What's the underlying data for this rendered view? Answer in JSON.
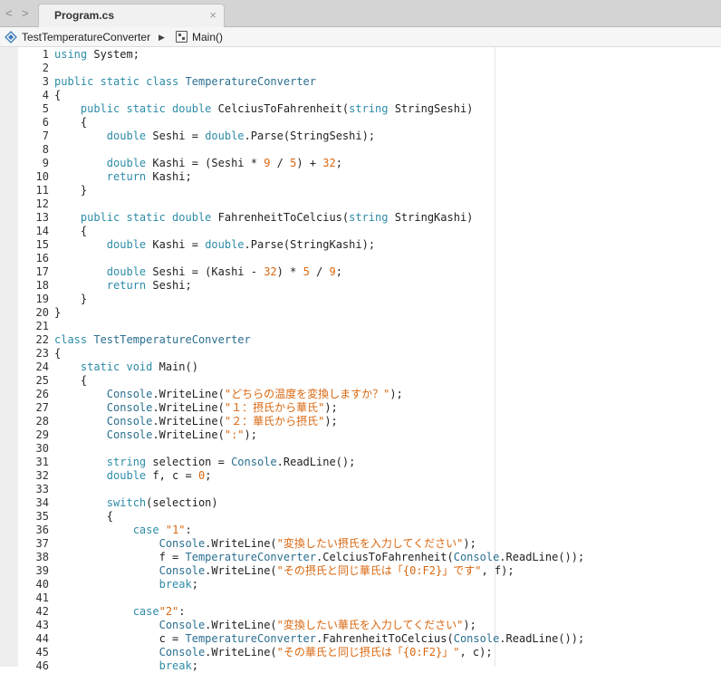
{
  "tabbar": {
    "back_label": "<",
    "forward_label": ">",
    "tab_title": "Program.cs",
    "close_label": "×"
  },
  "breadcrumb": {
    "namespace": "TestTemperatureConverter",
    "separator": "▶",
    "method": "Main()"
  },
  "colors": {
    "keyword": "#2e8ca8",
    "type": "#2a6f90",
    "string": "#d9670f",
    "number": "#d9670f",
    "plain": "#222222"
  },
  "editor": {
    "lines": [
      {
        "n": "1",
        "tokens": [
          [
            "kw",
            "using"
          ],
          [
            "p",
            " System;"
          ]
        ]
      },
      {
        "n": "2",
        "tokens": []
      },
      {
        "n": "3",
        "tokens": [
          [
            "kw",
            "public static class"
          ],
          [
            "p",
            " "
          ],
          [
            "ty",
            "TemperatureConverter"
          ]
        ]
      },
      {
        "n": "4",
        "tokens": [
          [
            "p",
            "{"
          ]
        ]
      },
      {
        "n": "5",
        "tokens": [
          [
            "p",
            "    "
          ],
          [
            "kw",
            "public static double"
          ],
          [
            "p",
            " CelciusToFahrenheit("
          ],
          [
            "kw",
            "string"
          ],
          [
            "p",
            " StringSeshi)"
          ]
        ]
      },
      {
        "n": "6",
        "tokens": [
          [
            "p",
            "    {"
          ]
        ]
      },
      {
        "n": "7",
        "tokens": [
          [
            "p",
            "        "
          ],
          [
            "kw",
            "double"
          ],
          [
            "p",
            " Seshi = "
          ],
          [
            "kw",
            "double"
          ],
          [
            "p",
            ".Parse(StringSeshi);"
          ]
        ]
      },
      {
        "n": "8",
        "tokens": []
      },
      {
        "n": "9",
        "tokens": [
          [
            "p",
            "        "
          ],
          [
            "kw",
            "double"
          ],
          [
            "p",
            " Kashi = (Seshi * "
          ],
          [
            "num",
            "9"
          ],
          [
            "p",
            " / "
          ],
          [
            "num",
            "5"
          ],
          [
            "p",
            ") + "
          ],
          [
            "num",
            "32"
          ],
          [
            "p",
            ";"
          ]
        ]
      },
      {
        "n": "10",
        "tokens": [
          [
            "p",
            "        "
          ],
          [
            "kw",
            "return"
          ],
          [
            "p",
            " Kashi;"
          ]
        ]
      },
      {
        "n": "11",
        "tokens": [
          [
            "p",
            "    }"
          ]
        ]
      },
      {
        "n": "12",
        "tokens": []
      },
      {
        "n": "13",
        "tokens": [
          [
            "p",
            "    "
          ],
          [
            "kw",
            "public static double"
          ],
          [
            "p",
            " FahrenheitToCelcius("
          ],
          [
            "kw",
            "string"
          ],
          [
            "p",
            " StringKashi)"
          ]
        ]
      },
      {
        "n": "14",
        "tokens": [
          [
            "p",
            "    {"
          ]
        ]
      },
      {
        "n": "15",
        "tokens": [
          [
            "p",
            "        "
          ],
          [
            "kw",
            "double"
          ],
          [
            "p",
            " Kashi = "
          ],
          [
            "kw",
            "double"
          ],
          [
            "p",
            ".Parse(StringKashi);"
          ]
        ]
      },
      {
        "n": "16",
        "tokens": []
      },
      {
        "n": "17",
        "tokens": [
          [
            "p",
            "        "
          ],
          [
            "kw",
            "double"
          ],
          [
            "p",
            " Seshi = (Kashi - "
          ],
          [
            "num",
            "32"
          ],
          [
            "p",
            ") * "
          ],
          [
            "num",
            "5"
          ],
          [
            "p",
            " / "
          ],
          [
            "num",
            "9"
          ],
          [
            "p",
            ";"
          ]
        ]
      },
      {
        "n": "18",
        "tokens": [
          [
            "p",
            "        "
          ],
          [
            "kw",
            "return"
          ],
          [
            "p",
            " Seshi;"
          ]
        ]
      },
      {
        "n": "19",
        "tokens": [
          [
            "p",
            "    }"
          ]
        ]
      },
      {
        "n": "20",
        "tokens": [
          [
            "p",
            "}"
          ]
        ]
      },
      {
        "n": "21",
        "tokens": []
      },
      {
        "n": "22",
        "tokens": [
          [
            "kw",
            "class"
          ],
          [
            "p",
            " "
          ],
          [
            "ty",
            "TestTemperatureConverter"
          ]
        ]
      },
      {
        "n": "23",
        "tokens": [
          [
            "p",
            "{"
          ]
        ]
      },
      {
        "n": "24",
        "tokens": [
          [
            "p",
            "    "
          ],
          [
            "kw",
            "static void"
          ],
          [
            "p",
            " Main()"
          ]
        ]
      },
      {
        "n": "25",
        "tokens": [
          [
            "p",
            "    {"
          ]
        ]
      },
      {
        "n": "26",
        "tokens": [
          [
            "p",
            "        "
          ],
          [
            "ty",
            "Console"
          ],
          [
            "p",
            ".WriteLine("
          ],
          [
            "str",
            "\"どちらの温度を変換しますか？\""
          ],
          [
            "p",
            ");"
          ]
        ]
      },
      {
        "n": "27",
        "tokens": [
          [
            "p",
            "        "
          ],
          [
            "ty",
            "Console"
          ],
          [
            "p",
            ".WriteLine("
          ],
          [
            "str",
            "\"１：摂氏から華氏\""
          ],
          [
            "p",
            ");"
          ]
        ]
      },
      {
        "n": "28",
        "tokens": [
          [
            "p",
            "        "
          ],
          [
            "ty",
            "Console"
          ],
          [
            "p",
            ".WriteLine("
          ],
          [
            "str",
            "\"２：華氏から摂氏\""
          ],
          [
            "p",
            ");"
          ]
        ]
      },
      {
        "n": "29",
        "tokens": [
          [
            "p",
            "        "
          ],
          [
            "ty",
            "Console"
          ],
          [
            "p",
            ".WriteLine("
          ],
          [
            "str",
            "\":\""
          ],
          [
            "p",
            ");"
          ]
        ]
      },
      {
        "n": "30",
        "tokens": []
      },
      {
        "n": "31",
        "tokens": [
          [
            "p",
            "        "
          ],
          [
            "kw",
            "string"
          ],
          [
            "p",
            " selection = "
          ],
          [
            "ty",
            "Console"
          ],
          [
            "p",
            ".ReadLine();"
          ]
        ]
      },
      {
        "n": "32",
        "tokens": [
          [
            "p",
            "        "
          ],
          [
            "kw",
            "double"
          ],
          [
            "p",
            " f, c = "
          ],
          [
            "num",
            "0"
          ],
          [
            "p",
            ";"
          ]
        ]
      },
      {
        "n": "33",
        "tokens": []
      },
      {
        "n": "34",
        "tokens": [
          [
            "p",
            "        "
          ],
          [
            "kw",
            "switch"
          ],
          [
            "p",
            "(selection)"
          ]
        ]
      },
      {
        "n": "35",
        "tokens": [
          [
            "p",
            "        {"
          ]
        ]
      },
      {
        "n": "36",
        "tokens": [
          [
            "p",
            "            "
          ],
          [
            "kw",
            "case"
          ],
          [
            "p",
            " "
          ],
          [
            "str",
            "\"1\""
          ],
          [
            "p",
            ":"
          ]
        ]
      },
      {
        "n": "37",
        "tokens": [
          [
            "p",
            "                "
          ],
          [
            "ty",
            "Console"
          ],
          [
            "p",
            ".WriteLine("
          ],
          [
            "str",
            "\"変換したい摂氏を入力してください\""
          ],
          [
            "p",
            ");"
          ]
        ]
      },
      {
        "n": "38",
        "tokens": [
          [
            "p",
            "                f = "
          ],
          [
            "ty",
            "TemperatureConverter"
          ],
          [
            "p",
            ".CelciusToFahrenheit("
          ],
          [
            "ty",
            "Console"
          ],
          [
            "p",
            ".ReadLine());"
          ]
        ]
      },
      {
        "n": "39",
        "tokens": [
          [
            "p",
            "                "
          ],
          [
            "ty",
            "Console"
          ],
          [
            "p",
            ".WriteLine("
          ],
          [
            "str",
            "\"その摂氏と同じ華氏は「{0:F2}」です\""
          ],
          [
            "p",
            ", f);"
          ]
        ]
      },
      {
        "n": "40",
        "tokens": [
          [
            "p",
            "                "
          ],
          [
            "kw",
            "break"
          ],
          [
            "p",
            ";"
          ]
        ]
      },
      {
        "n": "41",
        "tokens": []
      },
      {
        "n": "42",
        "tokens": [
          [
            "p",
            "            "
          ],
          [
            "kw",
            "case"
          ],
          [
            "str",
            "\"2\""
          ],
          [
            "p",
            ":"
          ]
        ]
      },
      {
        "n": "43",
        "tokens": [
          [
            "p",
            "                "
          ],
          [
            "ty",
            "Console"
          ],
          [
            "p",
            ".WriteLine("
          ],
          [
            "str",
            "\"変換したい華氏を入力してください\""
          ],
          [
            "p",
            ");"
          ]
        ]
      },
      {
        "n": "44",
        "tokens": [
          [
            "p",
            "                c = "
          ],
          [
            "ty",
            "TemperatureConverter"
          ],
          [
            "p",
            ".FahrenheitToCelcius("
          ],
          [
            "ty",
            "Console"
          ],
          [
            "p",
            ".ReadLine());"
          ]
        ]
      },
      {
        "n": "45",
        "tokens": [
          [
            "p",
            "                "
          ],
          [
            "ty",
            "Console"
          ],
          [
            "p",
            ".WriteLine("
          ],
          [
            "str",
            "\"その華氏と同じ摂氏は「{0:F2}」\""
          ],
          [
            "p",
            ", c);"
          ]
        ]
      },
      {
        "n": "46",
        "tokens": [
          [
            "p",
            "                "
          ],
          [
            "kw",
            "break"
          ],
          [
            "p",
            ";"
          ]
        ]
      }
    ]
  }
}
